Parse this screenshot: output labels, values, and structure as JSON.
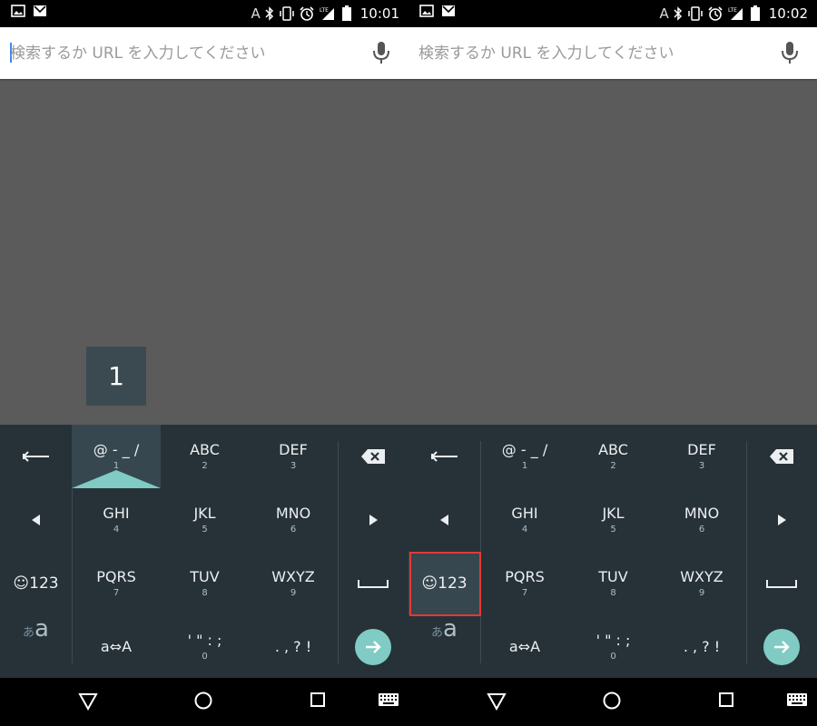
{
  "screens": [
    {
      "status": {
        "time": "10:01",
        "ime_indicator": "A",
        "network": "LTE"
      },
      "search": {
        "placeholder": "検索するか URL を入力してください"
      },
      "popup": {
        "visible": true,
        "char": "1"
      },
      "keyboard": {
        "active_key": "@ - _ /",
        "keys": [
          {
            "main": "@ - _ /",
            "sub": "1"
          },
          {
            "main": "ABC",
            "sub": "2"
          },
          {
            "main": "DEF",
            "sub": "3"
          },
          {
            "main": "GHI",
            "sub": "4"
          },
          {
            "main": "JKL",
            "sub": "5"
          },
          {
            "main": "MNO",
            "sub": "6"
          },
          {
            "main": "PQRS",
            "sub": "7"
          },
          {
            "main": "TUV",
            "sub": "8"
          },
          {
            "main": "WXYZ",
            "sub": "9"
          },
          {
            "main": "a⇔A",
            "sub": ""
          },
          {
            "main": "' \" : ;",
            "sub": "0"
          },
          {
            "main": ". , ? !",
            "sub": ""
          }
        ],
        "emoji_key_label": "☺123",
        "kana_key_small": "あ",
        "kana_key_large": "a",
        "highlighted": false
      }
    },
    {
      "status": {
        "time": "10:02",
        "ime_indicator": "A",
        "network": "LTE"
      },
      "search": {
        "placeholder": "検索するか URL を入力してください"
      },
      "popup": {
        "visible": false,
        "char": ""
      },
      "keyboard": {
        "active_key": "",
        "keys": [
          {
            "main": "@ - _ /",
            "sub": "1"
          },
          {
            "main": "ABC",
            "sub": "2"
          },
          {
            "main": "DEF",
            "sub": "3"
          },
          {
            "main": "GHI",
            "sub": "4"
          },
          {
            "main": "JKL",
            "sub": "5"
          },
          {
            "main": "MNO",
            "sub": "6"
          },
          {
            "main": "PQRS",
            "sub": "7"
          },
          {
            "main": "TUV",
            "sub": "8"
          },
          {
            "main": "WXYZ",
            "sub": "9"
          },
          {
            "main": "a⇔A",
            "sub": ""
          },
          {
            "main": "' \" : ;",
            "sub": "0"
          },
          {
            "main": ". , ? !",
            "sub": ""
          }
        ],
        "emoji_key_label": "☺123",
        "kana_key_small": "あ",
        "kana_key_large": "a",
        "highlighted": true
      }
    }
  ],
  "colors": {
    "keyboard_bg": "#263238",
    "accent": "#80cbc4",
    "highlight": "#e53935",
    "content_bg": "#5b5b5b"
  }
}
